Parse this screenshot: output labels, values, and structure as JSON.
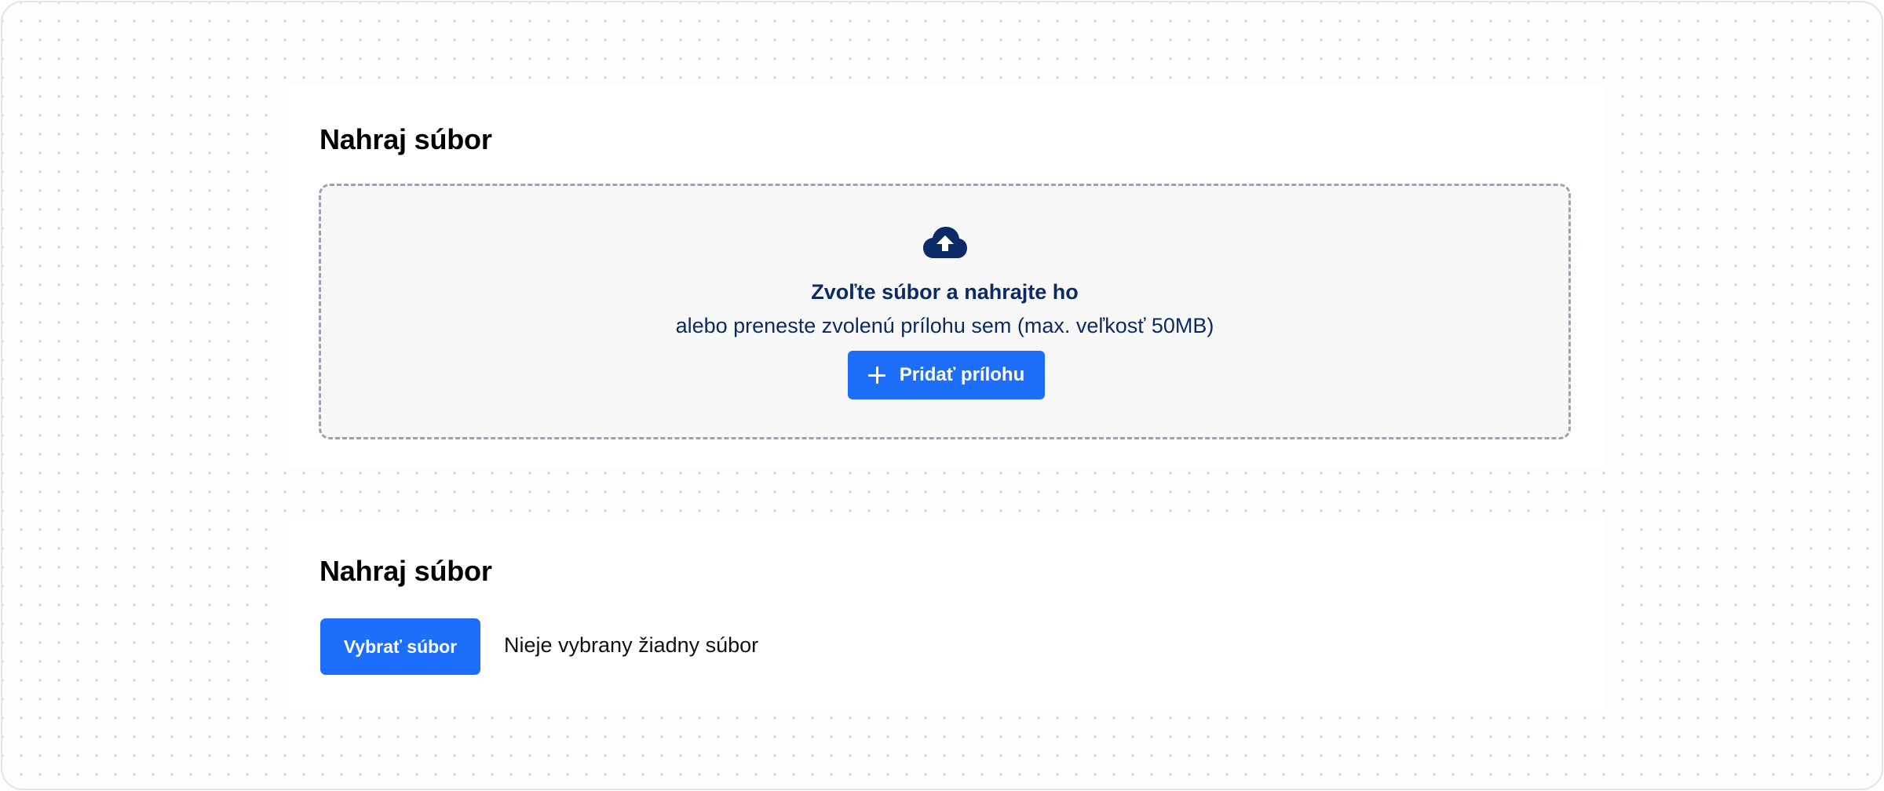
{
  "colors": {
    "accent": "#1d6ffb",
    "dropzone_text": "#0b2a66",
    "dropzone_border": "#9ca3af",
    "dropzone_background": "#f8f8f9"
  },
  "dropzone_card": {
    "title": "Nahraj súbor",
    "icon": "cloud-upload-icon",
    "heading": "Zvoľte súbor a nahrajte ho",
    "subtext": "alebo preneste zvolenú prílohu sem (max. veľkosť 50MB)",
    "button": {
      "icon": "plus-icon",
      "label": "Pridať prílohu"
    }
  },
  "file_input_card": {
    "title": "Nahraj súbor",
    "button_label": "Vybrať súbor",
    "status_text": "Nieje vybrany žiadny súbor"
  }
}
